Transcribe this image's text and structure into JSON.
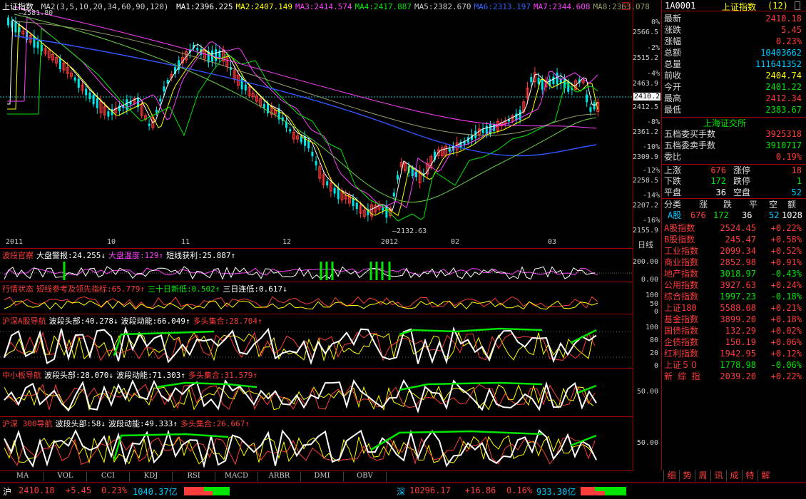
{
  "main": {
    "title": "上证指数",
    "ma_label": "MA2(3,5,10,20,34,60,90,120)",
    "ma_values": [
      {
        "label": "MA1:2396.225",
        "color": "#ffffff"
      },
      {
        "label": "MA2:2407.149",
        "color": "#ffff00"
      },
      {
        "label": "MA3:2414.574",
        "color": "#ff40ff"
      },
      {
        "label": "MA4:2417.887",
        "color": "#00e600"
      },
      {
        "label": "MA5:2382.670",
        "color": "#cccccc"
      },
      {
        "label": "MA6:2313.197",
        "color": "#3366ff"
      },
      {
        "label": "MA7:2344.608",
        "color": "#ff40ff"
      },
      {
        "label": "MA8:2363.078",
        "color": "#999966"
      }
    ],
    "high_marker": "2581.80",
    "low_marker": "2132.63",
    "current_price_marker": "2410.2",
    "price_axis": [
      "2566.5",
      "2515.2",
      "2463.9",
      "2412.5",
      "2361.2",
      "2309.9",
      "2258.5",
      "2207.2",
      "2155.9"
    ],
    "pct_axis": [
      "0%",
      "-2%",
      "-4%",
      "-6%",
      "-8%",
      "-10%",
      "-12%",
      "-14%",
      "-16%"
    ],
    "date_labels": [
      "2011",
      "10",
      "11",
      "12",
      "2012",
      "02",
      "03"
    ],
    "date_unit": "日线"
  },
  "indicators": [
    {
      "name": "波段官察",
      "items": [
        {
          "t": "大盘警报:24.255↓",
          "c": "#ffffff"
        },
        {
          "t": "大盘温度:129↑",
          "c": "#ff40ff"
        },
        {
          "t": "短线获利:25.887↑",
          "c": "#ffffff"
        }
      ],
      "axis": [
        "200.00",
        "0.00"
      ]
    },
    {
      "name": "行情状态",
      "items": [
        {
          "t": "短线参考及领先指标:65.779↑",
          "c": "#ff3c3c"
        },
        {
          "t": "三十日新低:0.502↑",
          "c": "#00e600"
        },
        {
          "t": "三日连低:0.617↓",
          "c": "#ffffff"
        }
      ],
      "axis": [
        "100",
        "50",
        "0"
      ]
    },
    {
      "name": "沪深A股导航",
      "items": [
        {
          "t": "波段头部:40.278↓",
          "c": "#ffffff"
        },
        {
          "t": "波段动能:66.049↑",
          "c": "#ffffff"
        },
        {
          "t": "多头集合:28.704↑",
          "c": "#ff3c3c"
        }
      ],
      "axis": [
        "100",
        "80",
        "20",
        "0"
      ]
    },
    {
      "name": "中小板导航",
      "items": [
        {
          "t": "波段头部:28.070↓",
          "c": "#ffffff"
        },
        {
          "t": "波段动能:71.303↑",
          "c": "#ffffff"
        },
        {
          "t": "多头集合:31.579↑",
          "c": "#ff3c3c"
        }
      ],
      "axis": [
        "50.00"
      ]
    },
    {
      "name": "沪深 300导航",
      "items": [
        {
          "t": "波段头部:58↓",
          "c": "#ffffff"
        },
        {
          "t": "波段动能:49.333↑",
          "c": "#ffffff"
        },
        {
          "t": "多头集合:26.667↑",
          "c": "#ff3c3c"
        }
      ],
      "axis": [
        "50.00"
      ]
    }
  ],
  "bottom_tabs": [
    "MA",
    "VOL",
    "CCI",
    "KDJ",
    "RSI",
    "MACD",
    "ARBR",
    "DMI",
    "OBV"
  ],
  "right": {
    "code": "1A0001",
    "name": "上证指数",
    "count": "(12)",
    "quote": [
      {
        "l": "最新",
        "v": "2410.18",
        "c": "red"
      },
      {
        "l": "涨跌",
        "v": "5.45",
        "c": "red"
      },
      {
        "l": "涨幅",
        "v": "0.23%",
        "c": "red"
      },
      {
        "l": "总额",
        "v": "10403662",
        "c": "cyan"
      },
      {
        "l": "总量",
        "v": "111641352",
        "c": "cyan"
      },
      {
        "l": "前收",
        "v": "2404.74",
        "c": "yellow"
      },
      {
        "l": "今开",
        "v": "2401.22",
        "c": "green"
      },
      {
        "l": "最高",
        "v": "2412.34",
        "c": "red"
      },
      {
        "l": "最低",
        "v": "2383.67",
        "c": "green"
      }
    ],
    "exchange": "上海证交所",
    "book": [
      {
        "l": "五档委买手数",
        "v": "3925318",
        "c": "red"
      },
      {
        "l": "五档委卖手数",
        "v": "3910717",
        "c": "green"
      },
      {
        "l": "委比",
        "v": "0.19%",
        "c": "red"
      }
    ],
    "breadth": [
      {
        "l": "上涨",
        "v": "676",
        "c": "red",
        "l2": "涨停",
        "v2": "18",
        "c2": "red"
      },
      {
        "l": "下跌",
        "v": "172",
        "c": "green",
        "l2": "跌停",
        "v2": "1",
        "c2": "green"
      },
      {
        "l": "平盘",
        "v": "36",
        "c": "white",
        "l2": "空盘",
        "v2": "52",
        "c2": "cyan"
      }
    ],
    "class_header": [
      "分类",
      "涨",
      "跌",
      "平",
      "空",
      "额"
    ],
    "class_row": {
      "name": "A股",
      "up": "676",
      "down": "172",
      "flat": "36",
      "empty": "52",
      "amount": "1028"
    },
    "indices": [
      {
        "n": "A股指数",
        "p": "2524.45",
        "c": "+0.22%",
        "col": "red"
      },
      {
        "n": "B股指数",
        "p": "245.47",
        "c": "+0.58%",
        "col": "red"
      },
      {
        "n": "工业指数",
        "p": "2099.34",
        "c": "+0.52%",
        "col": "red"
      },
      {
        "n": "商业指数",
        "p": "2852.98",
        "c": "+0.91%",
        "col": "red"
      },
      {
        "n": "地产指数",
        "p": "3018.97",
        "c": "-0.43%",
        "col": "green"
      },
      {
        "n": "公用指数",
        "p": "3927.63",
        "c": "+0.24%",
        "col": "red"
      },
      {
        "n": "综合指数",
        "p": "1997.23",
        "c": "-0.18%",
        "col": "green"
      },
      {
        "n": "上证180",
        "p": "5588.08",
        "c": "+0.21%",
        "col": "red"
      },
      {
        "n": "基金指数",
        "p": "3899.20",
        "c": "+0.18%",
        "col": "red"
      },
      {
        "n": "国债指数",
        "p": "132.29",
        "c": "+0.02%",
        "col": "red"
      },
      {
        "n": "企债指数",
        "p": "150.19",
        "c": "+0.06%",
        "col": "red"
      },
      {
        "n": "红利指数",
        "p": "1942.95",
        "c": "+0.12%",
        "col": "red"
      },
      {
        "n": "上证５０",
        "p": "1778.98",
        "c": "-0.06%",
        "col": "green"
      },
      {
        "n": "新 综 指",
        "p": "2039.20",
        "c": "+0.22%",
        "col": "red"
      }
    ],
    "tabs": [
      "细",
      "势",
      "周",
      "讯",
      "成",
      "特",
      "解"
    ]
  },
  "status": {
    "sh_label": "沪",
    "sh_price": "2410.18",
    "sh_change": "+5.45",
    "sh_pct": "0.23%",
    "sh_amount": "1040.37亿",
    "sz_label": "深",
    "sz_price": "10296.17",
    "sz_change": "+16.86",
    "sz_pct": "0.16%",
    "sz_amount": "933.30亿"
  }
}
